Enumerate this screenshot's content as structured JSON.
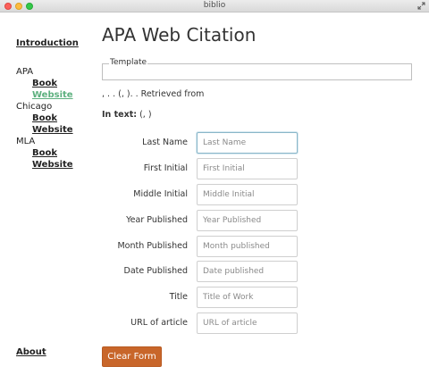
{
  "window": {
    "title": "biblio"
  },
  "sidebar": {
    "intro": "Introduction",
    "groups": [
      {
        "label": "APA",
        "items": [
          "Book",
          "Website"
        ]
      },
      {
        "label": "Chicago",
        "items": [
          "Book",
          "Website"
        ]
      },
      {
        "label": "MLA",
        "items": [
          "Book",
          "Website"
        ]
      }
    ],
    "about": "About",
    "active_color": "#5cb07e"
  },
  "main": {
    "title": "APA Web Citation",
    "template_legend": "Template",
    "template_value": "",
    "citation_text": ", . . (, ). . Retrieved from",
    "intext_label": "In text:",
    "intext_value": "(, )",
    "fields": [
      {
        "label": "Last Name",
        "placeholder": "Last Name",
        "value": ""
      },
      {
        "label": "First Initial",
        "placeholder": "First Initial",
        "value": ""
      },
      {
        "label": "Middle Initial",
        "placeholder": "Middle Initial",
        "value": ""
      },
      {
        "label": "Year Published",
        "placeholder": "Year Published",
        "value": ""
      },
      {
        "label": "Month Published",
        "placeholder": "Month published",
        "value": ""
      },
      {
        "label": "Date Published",
        "placeholder": "Date published",
        "value": ""
      },
      {
        "label": "Title",
        "placeholder": "Title of Work",
        "value": ""
      },
      {
        "label": "URL of article",
        "placeholder": "URL of article",
        "value": ""
      }
    ],
    "clear_button": "Clear Form",
    "button_color": "#c8662a"
  }
}
